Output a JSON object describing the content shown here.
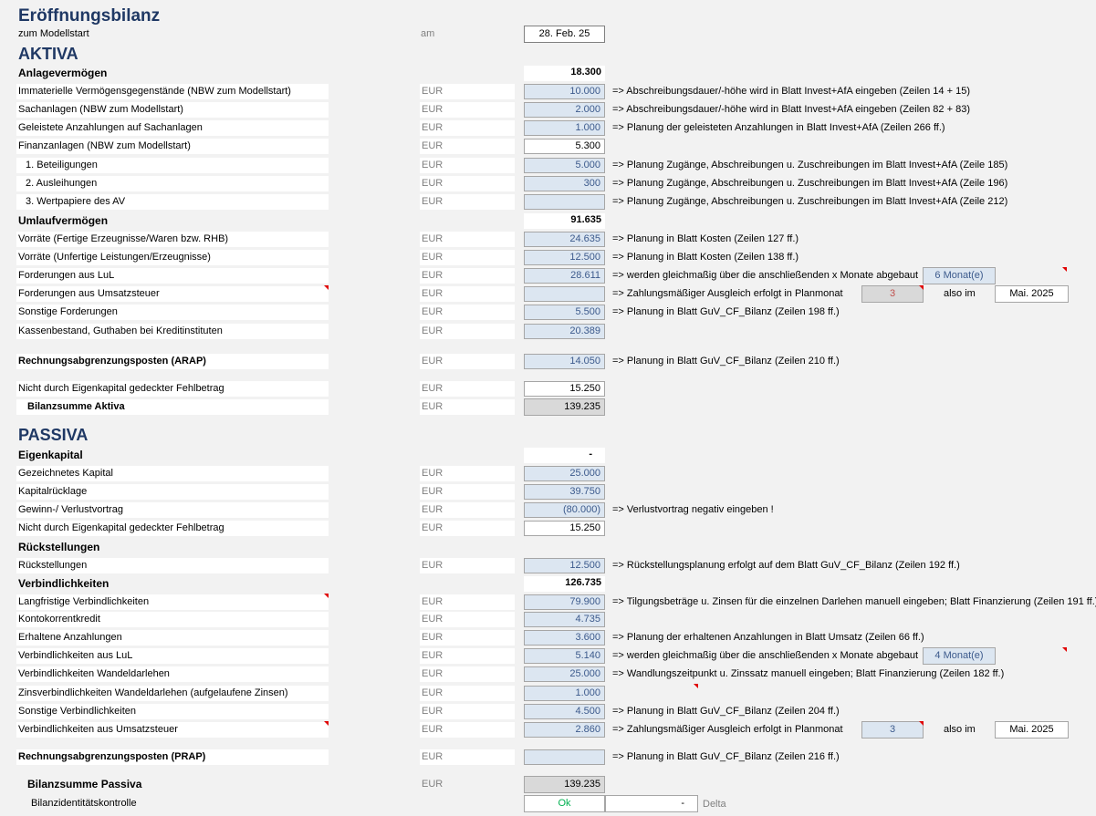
{
  "title": "Eröffnungsbilanz",
  "subtitle": "zum Modellstart",
  "date_label": "am",
  "date_value": "28. Feb. 25",
  "aktiva_heading": "AKTIVA",
  "passiva_heading": "PASSIVA",
  "unit": "EUR",
  "rows": [
    {
      "label": "Anlagevermögen",
      "value": "18.300"
    },
    {
      "label": "Immaterielle Vermögensgegenstände (NBW zum Modellstart)",
      "value": "10.000",
      "note": "=> Abschreibungsdauer/-höhe wird in Blatt Invest+AfA eingeben (Zeilen 14 + 15)"
    },
    {
      "label": "Sachanlagen (NBW zum Modellstart)",
      "value": "2.000",
      "note": "=> Abschreibungsdauer/-höhe wird in Blatt Invest+AfA eingeben (Zeilen 82 + 83)"
    },
    {
      "label": "Geleistete Anzahlungen auf Sachanlagen",
      "value": "1.000",
      "note": "=> Planung der geleisteten Anzahlungen in Blatt Invest+AfA (Zeilen 266 ff.)"
    },
    {
      "label": "Finanzanlagen (NBW zum Modellstart)",
      "value": "5.300"
    },
    {
      "label": "1. Beteiligungen",
      "value": "5.000",
      "note": "=> Planung Zugänge, Abschreibungen u. Zuschreibungen im Blatt Invest+AfA (Zeile 185)"
    },
    {
      "label": "2. Ausleihungen",
      "value": "300",
      "note": "=> Planung Zugänge, Abschreibungen u. Zuschreibungen im Blatt Invest+AfA (Zeile 196)"
    },
    {
      "label": "3. Wertpapiere des AV",
      "value": "",
      "note": "=> Planung Zugänge, Abschreibungen u. Zuschreibungen im Blatt Invest+AfA (Zeile 212)"
    },
    {
      "label": "Umlaufvermögen",
      "value": "91.635"
    },
    {
      "label": "Vorräte (Fertige Erzeugnisse/Waren bzw. RHB)",
      "value": "24.635",
      "note": "=> Planung in Blatt Kosten (Zeilen 127 ff.)"
    },
    {
      "label": "Vorräte (Unfertige Leistungen/Erzeugnisse)",
      "value": "12.500",
      "note": "=> Planung in Blatt Kosten (Zeilen 138 ff.)"
    },
    {
      "label": "Forderungen aus LuL",
      "value": "28.611",
      "note": "=> werden gleichmaßig über die anschließenden x Monate abgebaut",
      "extra": "6 Monat(e)"
    },
    {
      "label": "Forderungen aus Umsatzsteuer",
      "value": "",
      "note": "=> Zahlungsmäßiger Ausgleich erfolgt in Planmonat",
      "extra": "3",
      "also": "also im",
      "month": "Mai. 2025"
    },
    {
      "label": "Sonstige Forderungen",
      "value": "5.500",
      "note": "=> Planung in Blatt GuV_CF_Bilanz (Zeilen 198 ff.)"
    },
    {
      "label": "Kassenbestand, Guthaben bei Kreditinstituten",
      "value": "20.389"
    },
    {
      "label": "Rechnungsabgrenzungsposten (ARAP)",
      "value": "14.050",
      "note": "=> Planung in Blatt GuV_CF_Bilanz (Zeilen 210 ff.)"
    },
    {
      "label": "Nicht durch Eigenkapital gedeckter Fehlbetrag",
      "value": "15.250"
    },
    {
      "label": "Bilanzsumme Aktiva",
      "value": "139.235"
    },
    {
      "label": "Eigenkapital",
      "value": "-"
    },
    {
      "label": "Gezeichnetes Kapital",
      "value": "25.000"
    },
    {
      "label": "Kapitalrücklage",
      "value": "39.750"
    },
    {
      "label": "Gewinn-/ Verlustvortrag",
      "value": "(80.000)",
      "note": "=> Verlustvortrag negativ eingeben !"
    },
    {
      "label": "Nicht durch Eigenkapital gedeckter Fehlbetrag",
      "value": "15.250"
    },
    {
      "label": "Rückstellungen"
    },
    {
      "label": "Rückstellungen",
      "value": "12.500",
      "note": "=> Rückstellungsplanung erfolgt auf dem Blatt GuV_CF_Bilanz (Zeilen 192 ff.)"
    },
    {
      "label": "Verbindlichkeiten",
      "value": "126.735"
    },
    {
      "label": "Langfristige Verbindlichkeiten",
      "value": "79.900",
      "note": "=> Tilgungsbeträge u. Zinsen für die einzelnen Darlehen manuell eingeben; Blatt Finanzierung (Zeilen 191 ff.)"
    },
    {
      "label": "Kontokorrentkredit",
      "value": "4.735"
    },
    {
      "label": "Erhaltene Anzahlungen",
      "value": "3.600",
      "note": "=> Planung der erhaltenen Anzahlungen in Blatt Umsatz (Zeilen 66 ff.)"
    },
    {
      "label": "Verbindlichkeiten aus LuL",
      "value": "5.140",
      "note": "=> werden gleichmaßig über die anschließenden x Monate abgebaut",
      "extra": "4 Monat(e)"
    },
    {
      "label": "Verbindlichkeiten Wandeldarlehen",
      "value": "25.000",
      "note": "=> Wandlungszeitpunkt u. Zinssatz manuell eingeben; Blatt Finanzierung (Zeilen 182 ff.)"
    },
    {
      "label": "Zinsverbindlichkeiten Wandeldarlehen (aufgelaufene Zinsen)",
      "value": "1.000"
    },
    {
      "label": "Sonstige Verbindlichkeiten",
      "value": "4.500",
      "note": "=> Planung in Blatt GuV_CF_Bilanz (Zeilen 204 ff.)"
    },
    {
      "label": "Verbindlichkeiten aus Umsatzsteuer",
      "value": "2.860",
      "note": "=> Zahlungsmäßiger Ausgleich erfolgt in Planmonat",
      "extra": "3",
      "also": "also im",
      "month": "Mai. 2025"
    },
    {
      "label": "Rechnungsabgrenzungsposten (PRAP)",
      "value": "",
      "note": "=> Planung in Blatt GuV_CF_Bilanz (Zeilen 216 ff.)"
    },
    {
      "label": "Bilanzsumme Passiva",
      "value": "139.235"
    },
    {
      "label": "Bilanzidentitätskontrolle",
      "value": "Ok",
      "delta_value": "-",
      "delta_label": "Delta"
    }
  ]
}
